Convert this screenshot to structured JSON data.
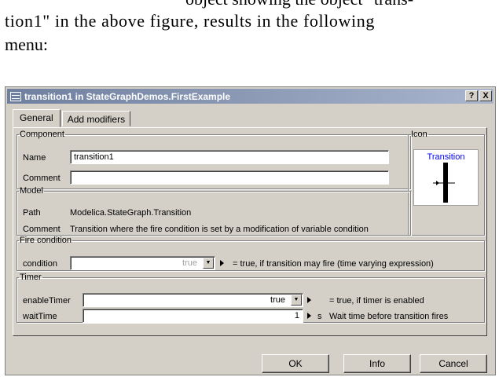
{
  "document": {
    "line1_partial": "object showing the object \"trans-",
    "line2": "tion1\" in the above figure, results in the following",
    "line3": "menu:"
  },
  "window": {
    "title": "transition1 in StateGraphDemos.FirstExample",
    "help_button": "?",
    "close_button": "X"
  },
  "tabs": [
    {
      "label": "General"
    },
    {
      "label": "Add modifiers"
    }
  ],
  "component": {
    "legend": "Component",
    "name_label": "Name",
    "name_value": "transition1",
    "comment_label": "Comment",
    "comment_value": ""
  },
  "icon_group": {
    "legend": "Icon",
    "caption": "Transition"
  },
  "model": {
    "legend": "Model",
    "path_label": "Path",
    "path_value": "Modelica.StateGraph.Transition",
    "comment_label": "Comment",
    "comment_value": "Transition where the fire condition is set by a modification of variable condition"
  },
  "fire_condition": {
    "legend": "Fire condition",
    "condition_label": "condition",
    "condition_value": "true",
    "condition_desc": "= true, if transition may fire (time varying expression)"
  },
  "timer": {
    "legend": "Timer",
    "enable_label": "enableTimer",
    "enable_value": "true",
    "enable_desc": "= true, if timer is enabled",
    "wait_label": "waitTime",
    "wait_value": "1",
    "wait_unit": "s",
    "wait_desc": "Wait time before transition fires"
  },
  "buttons": {
    "ok": "OK",
    "info": "Info",
    "cancel": "Cancel"
  },
  "colors": {
    "title_gradient_start": "#6f7f9f",
    "title_gradient_end": "#a9b5cd",
    "dialog_bg": "#d4d0c8",
    "icon_caption": "#0000ff"
  }
}
